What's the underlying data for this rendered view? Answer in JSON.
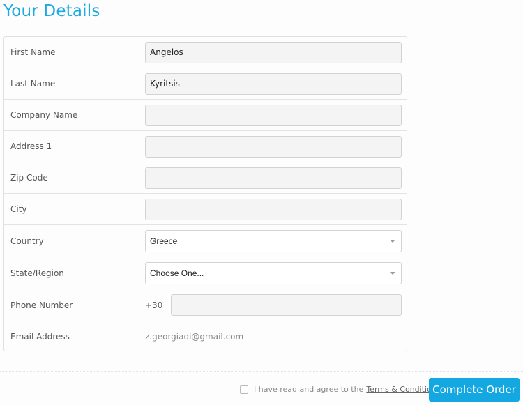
{
  "page": {
    "title": "Your Details"
  },
  "form": {
    "first_name": {
      "label": "First Name",
      "value": "Angelos"
    },
    "last_name": {
      "label": "Last Name",
      "value": "Kyritsis"
    },
    "company_name": {
      "label": "Company Name",
      "value": ""
    },
    "address1": {
      "label": "Address 1",
      "value": ""
    },
    "zip": {
      "label": "Zip Code",
      "value": ""
    },
    "city": {
      "label": "City",
      "value": ""
    },
    "country": {
      "label": "Country",
      "selected": "Greece"
    },
    "state": {
      "label": "State/Region",
      "selected": "Choose One..."
    },
    "phone": {
      "label": "Phone Number",
      "prefix": "+30",
      "value": ""
    },
    "email": {
      "label": "Email Address",
      "value": "z.georgiadi@gmail.com"
    }
  },
  "footer": {
    "agree_text": "I have read and agree to the",
    "terms_link": "Terms & Conditions",
    "complete_button": "Complete Order"
  },
  "colors": {
    "accent": "#1ea9e1",
    "button": "#14a8e3"
  }
}
